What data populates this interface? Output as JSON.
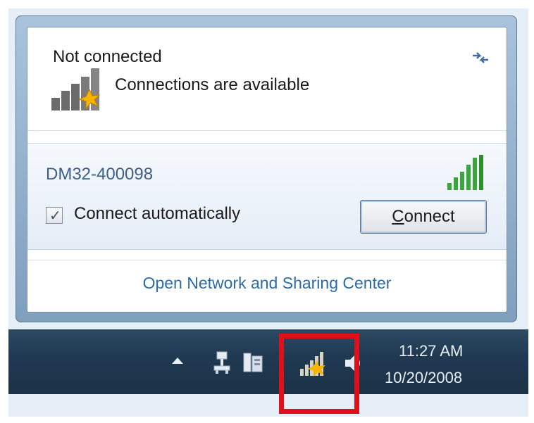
{
  "popup": {
    "status_title": "Not connected",
    "status_subtitle": "Connections are available",
    "network": {
      "name": "DM32-400098",
      "connect_automatically_label": "Connect automatically",
      "connect_automatically_checked": true,
      "connect_button": {
        "prefix": "C",
        "rest": "onnect"
      }
    },
    "footer_link": "Open Network and Sharing Center"
  },
  "taskbar": {
    "time": "11:27 AM",
    "date": "10/20/2008",
    "tray_icons": [
      "show-hidden-icons",
      "network-device-icon",
      "action-center-icon",
      "wireless-network-icon",
      "volume-icon"
    ]
  },
  "colors": {
    "highlight": "#e0101a",
    "link": "#2b6ca6",
    "network_name": "#3b5f86",
    "signal_green": "#3aa53a"
  }
}
